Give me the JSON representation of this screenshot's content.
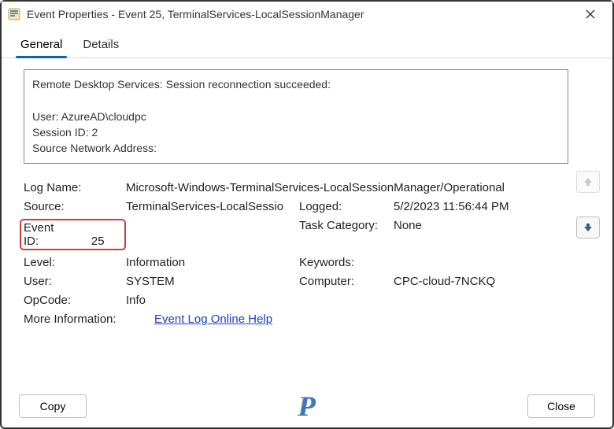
{
  "window": {
    "title": "Event Properties - Event 25, TerminalServices-LocalSessionManager"
  },
  "tabs": {
    "general": "General",
    "details": "Details"
  },
  "description": "Remote Desktop Services: Session reconnection succeeded:\n\nUser: AzureAD\\cloudpc\nSession ID: 2\nSource Network Address:",
  "fields": {
    "log_name_label": "Log Name:",
    "log_name_value": "Microsoft-Windows-TerminalServices-LocalSessionManager/Operational",
    "source_label": "Source:",
    "source_value": "TerminalServices-LocalSessio",
    "logged_label": "Logged:",
    "logged_value": "5/2/2023 11:56:44 PM",
    "event_id_label": "Event ID:",
    "event_id_value": "25",
    "task_category_label": "Task Category:",
    "task_category_value": "None",
    "level_label": "Level:",
    "level_value": "Information",
    "keywords_label": "Keywords:",
    "keywords_value": "",
    "user_label": "User:",
    "user_value": "SYSTEM",
    "computer_label": "Computer:",
    "computer_value": "CPC-cloud-7NCKQ",
    "opcode_label": "OpCode:",
    "opcode_value": "Info",
    "more_info_label": "More Information:",
    "more_info_link": "Event Log Online Help"
  },
  "buttons": {
    "copy": "Copy",
    "close": "Close"
  },
  "watermark": "P"
}
